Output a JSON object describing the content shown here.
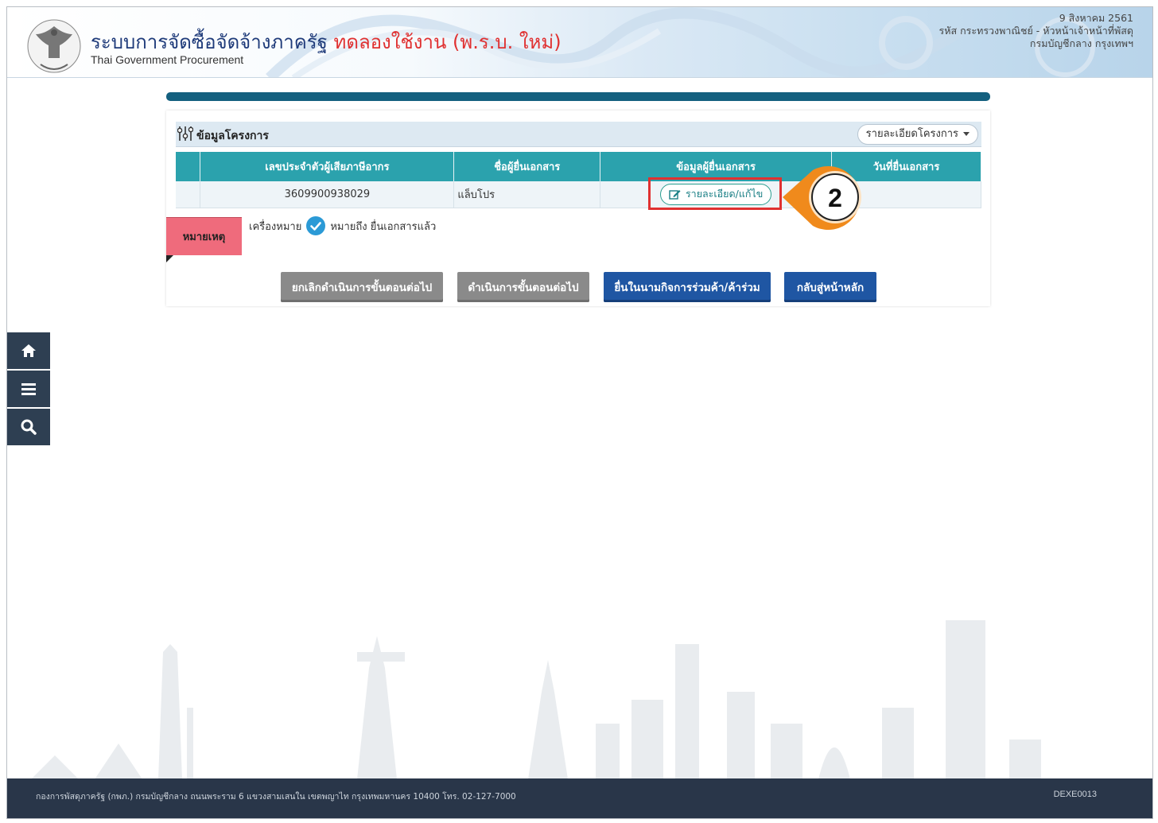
{
  "header": {
    "title": "ระบบการจัดซื้อจัดจ้างภาครัฐ",
    "trial_label": "ทดลองใช้งาน (พ.ร.บ. ใหม่)",
    "subtitle": "Thai Government Procurement",
    "date": "9 สิงหาคม 2561",
    "user_role": "รหัส กระทรวงพาณิชย์ - หัวหน้าเจ้าหน้าที่พัสดุ",
    "department": "กรมบัญชีกลาง กรุงเทพฯ"
  },
  "sidenav": {
    "items": [
      {
        "icon": "home-icon"
      },
      {
        "icon": "menu-icon"
      },
      {
        "icon": "search-icon"
      }
    ]
  },
  "panel": {
    "title": "ข้อมูลโครงการ",
    "details_dropdown": "รายละเอียดโครงการ",
    "table": {
      "columns": [
        "",
        "เลขประจำตัวผู้เสียภาษีอากร",
        "ชื่อผู้ยื่นเอกสาร",
        "ข้อมูลผู้ยื่นเอกสาร",
        "วันที่ยื่นเอกสาร"
      ],
      "rows": [
        {
          "tax_id": "3609900938029",
          "submitter_name": "แล็บโปร",
          "edit_label": "รายละเอียด/แก้ไข",
          "submit_date": ""
        }
      ]
    },
    "note_tag": "หมายเหตุ",
    "legend_prefix": "เครื่องหมาย",
    "legend_text": "หมายถึง ยื่นเอกสารแล้ว",
    "actions": {
      "cancel_next": "ยกเลิกดำเนินการขั้นตอนต่อไป",
      "proceed_next": "ดำเนินการขั้นตอนต่อไป",
      "joint_venture": "ยื่นในนามกิจการร่วมค้า/ค้าร่วม",
      "back_home": "กลับสู่หน้าหลัก"
    }
  },
  "callout": {
    "number": "2"
  },
  "footer": {
    "address": "กองการพัสดุภาครัฐ (กพภ.) กรมบัญชีกลาง ถนนพระราม 6 แขวงสามเสนใน เขตพญาไท กรุงเทพมหานคร 10400 โทร. 02-127-7000",
    "code": "DEXE0013"
  },
  "colors": {
    "brand_navy": "#293649",
    "table_header": "#2ba2ad",
    "button_blue": "#1f56a3",
    "button_grey": "#8a8a8a",
    "callout_orange": "#f08a1c",
    "highlight_red": "#e03131"
  }
}
